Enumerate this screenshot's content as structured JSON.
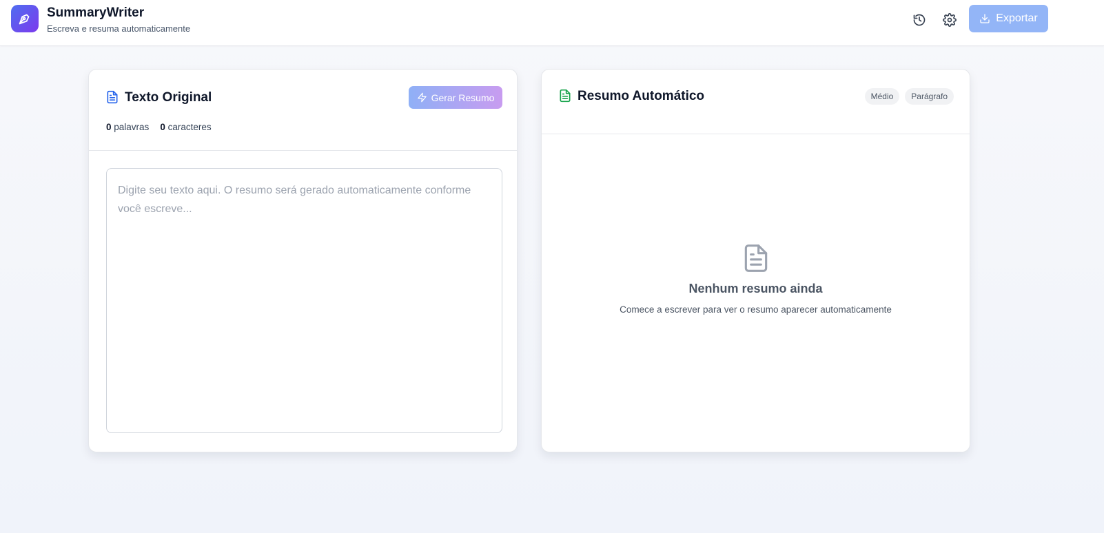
{
  "app": {
    "title": "SummaryWriter",
    "subtitle": "Escreva e resuma automaticamente",
    "logo_icon": "pen-nib-icon"
  },
  "header": {
    "history_icon": "history-icon",
    "settings_icon": "gear-icon",
    "export_label": "Exportar",
    "export_icon": "download-icon"
  },
  "editor": {
    "title": "Texto Original",
    "title_icon": "document-icon",
    "generate_label": "Gerar Resumo",
    "generate_icon": "lightning-icon",
    "word_count": "0",
    "word_label": "palavras",
    "char_count": "0",
    "char_label": "caracteres",
    "placeholder": "Digite seu texto aqui. O resumo será gerado automaticamente conforme você escreve...",
    "value": ""
  },
  "summary": {
    "title": "Resumo Automático",
    "title_icon": "document-icon",
    "badges": [
      "Médio",
      "Parágrafo"
    ],
    "empty_icon": "document-icon",
    "empty_title": "Nenhum resumo ainda",
    "empty_subtitle": "Comece a escrever para ver o resumo aparecer automaticamente"
  },
  "colors": {
    "accent": "#4f6ef0",
    "accent_secondary": "#7c3aed",
    "export_button": "#93b5f7",
    "original_icon": "#2563eb",
    "summary_icon": "#16a34a"
  }
}
